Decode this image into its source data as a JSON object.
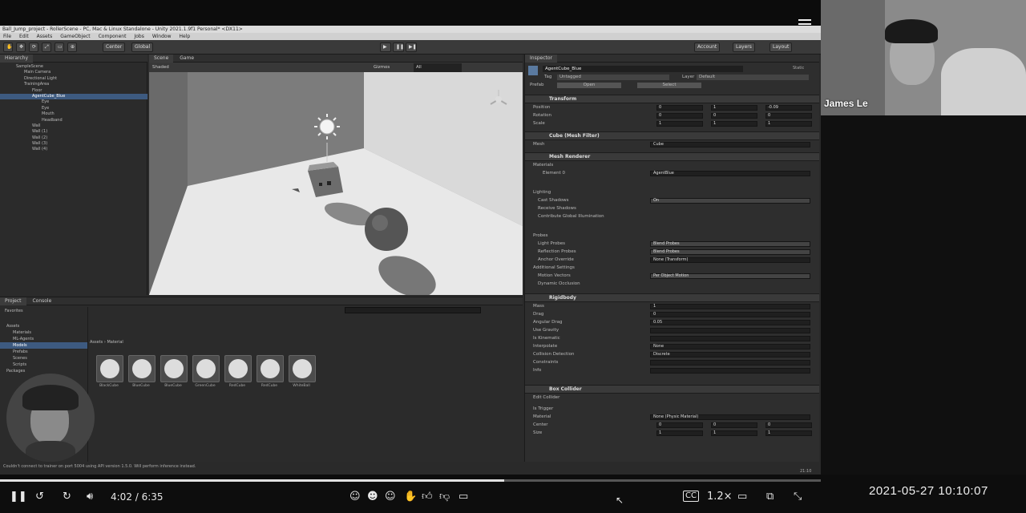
{
  "unity": {
    "title": "Ball_Jump_project - RollerScene - PC, Mac & Linux Standalone - Unity 2021.1.9f1 Personal* <DX11>",
    "menu": [
      "File",
      "Edit",
      "Assets",
      "GameObject",
      "Component",
      "Jobs",
      "Window",
      "Help"
    ],
    "toolbar": {
      "pivot": "Center",
      "space": "Global",
      "account": "Account",
      "layers": "Layers",
      "layout": "Layout"
    },
    "hierarchy": {
      "tab": "Hierarchy",
      "items": [
        "SampleScene",
        "Main Camera",
        "Directional Light",
        "TrainingArea",
        "Floor",
        "AgentCube_Blue",
        "Eye",
        "Eye",
        "Mouth",
        "Headband",
        "Wall",
        "Wall (1)",
        "Wall (2)",
        "Wall (3)",
        "Wall (4)"
      ]
    },
    "scene": {
      "tabs": [
        "Scene",
        "Game"
      ],
      "shading": "Shaded",
      "gizmos": "Gizmos",
      "search": "All"
    },
    "project": {
      "tabs": [
        "Project",
        "Console"
      ],
      "favorites": "Favorites",
      "breadcrumb": [
        "Assets",
        "Material"
      ],
      "folders": [
        "Assets",
        "Materials",
        "ML-Agents",
        "Models",
        "Prefabs",
        "Scenes",
        "Scripts",
        "Packages"
      ],
      "assets": [
        "BlackCube",
        "BlueCube",
        "BlueCube",
        "GreenCube",
        "RedCube",
        "RedCube",
        "WhiteBall"
      ]
    },
    "inspector": {
      "tab": "Inspector",
      "object_name": "AgentCube_Blue",
      "static": "Static",
      "tag_label": "Tag",
      "tag": "Untagged",
      "layer_label": "Layer",
      "layer": "Default",
      "prefab_label": "Prefab",
      "open": "Open",
      "select": "Select",
      "transform": {
        "title": "Transform",
        "position": {
          "label": "Position",
          "x": "0",
          "y": "1",
          "z": "-0.09"
        },
        "rotation": {
          "label": "Rotation",
          "x": "0",
          "y": "0",
          "z": "0"
        },
        "scale": {
          "label": "Scale",
          "x": "1",
          "y": "1",
          "z": "1"
        }
      },
      "mesh_filter": {
        "title": "Cube (Mesh Filter)",
        "mesh_label": "Mesh",
        "mesh": "Cube"
      },
      "mesh_renderer": {
        "title": "Mesh Renderer",
        "materials": "Materials",
        "element": "Element 0",
        "element_value": "AgentBlue",
        "lighting": "Lighting",
        "cast_shadows": "Cast Shadows",
        "cast_value": "On",
        "receive_shadows": "Receive Shadows",
        "contribute_gi": "Contribute Global Illumination",
        "probes": "Probes",
        "light_probes": "Light Probes",
        "light_value": "Blend Probes",
        "reflection_probes": "Reflection Probes",
        "reflection_value": "Blend Probes",
        "anchor_override": "Anchor Override",
        "anchor_value": "None (Transform)",
        "additional": "Additional Settings",
        "motion_vectors": "Motion Vectors",
        "motion_value": "Per Object Motion",
        "dynamic_occlusion": "Dynamic Occlusion"
      },
      "rigidbody": {
        "title": "Rigidbody",
        "rows": [
          {
            "label": "Mass",
            "value": "1"
          },
          {
            "label": "Drag",
            "value": "0"
          },
          {
            "label": "Angular Drag",
            "value": "0.05"
          },
          {
            "label": "Use Gravity",
            "value": ""
          },
          {
            "label": "Is Kinematic",
            "value": ""
          },
          {
            "label": "Interpolate",
            "value": "None"
          },
          {
            "label": "Collision Detection",
            "value": "Discrete"
          },
          {
            "label": "Constraints",
            "value": ""
          },
          {
            "label": "Info",
            "value": ""
          }
        ]
      },
      "box_collider": {
        "title": "Box Collider",
        "edit": "Edit Collider",
        "trigger": "Is Trigger",
        "material": "Material",
        "material_value": "None (Physic Material)",
        "center": "Center",
        "size": "Size",
        "center_xyz": [
          "0",
          "0",
          "0"
        ],
        "size_xyz": [
          "1",
          "1",
          "1"
        ]
      }
    },
    "status": "Couldn't connect to trainer on port 5004 using API version 1.5.0. Will perform inference instead.",
    "clock": "21:10"
  },
  "video": {
    "time": "4:02 / 6:35",
    "progress": 0.614,
    "speed": "1.2×",
    "cc": "CC"
  },
  "webcam": {
    "name": "James Le"
  },
  "timestamp": "2021-05-27  10:10:07",
  "colors": {
    "selection": "#3d5a80",
    "background": "#101010"
  }
}
